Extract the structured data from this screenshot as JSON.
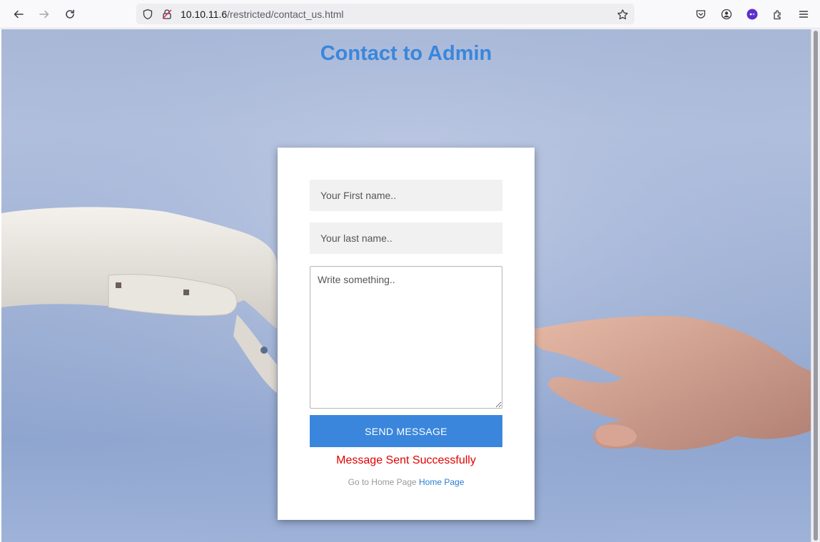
{
  "browser": {
    "url_host": "10.10.11.6",
    "url_path": "/restricted/contact_us.html",
    "icons": [
      "back-arrow-icon",
      "forward-arrow-icon",
      "reload-icon",
      "shield-icon",
      "insecure-lock-icon",
      "bookmark-star-icon",
      "pocket-icon",
      "account-icon",
      "extension-badge-icon",
      "extensions-icon",
      "menu-icon"
    ]
  },
  "page": {
    "title": "Contact to Admin",
    "form": {
      "first_name_placeholder": "Your First name..",
      "last_name_placeholder": "Your last name..",
      "message_placeholder": "Write something..",
      "send_label": "SEND MESSAGE"
    },
    "success_message": "Message Sent Successfully",
    "home_prefix": "Go to Home Page",
    "home_link": "Home Page"
  },
  "colors": {
    "accent": "#3a86dc",
    "success_text": "#e00000"
  }
}
